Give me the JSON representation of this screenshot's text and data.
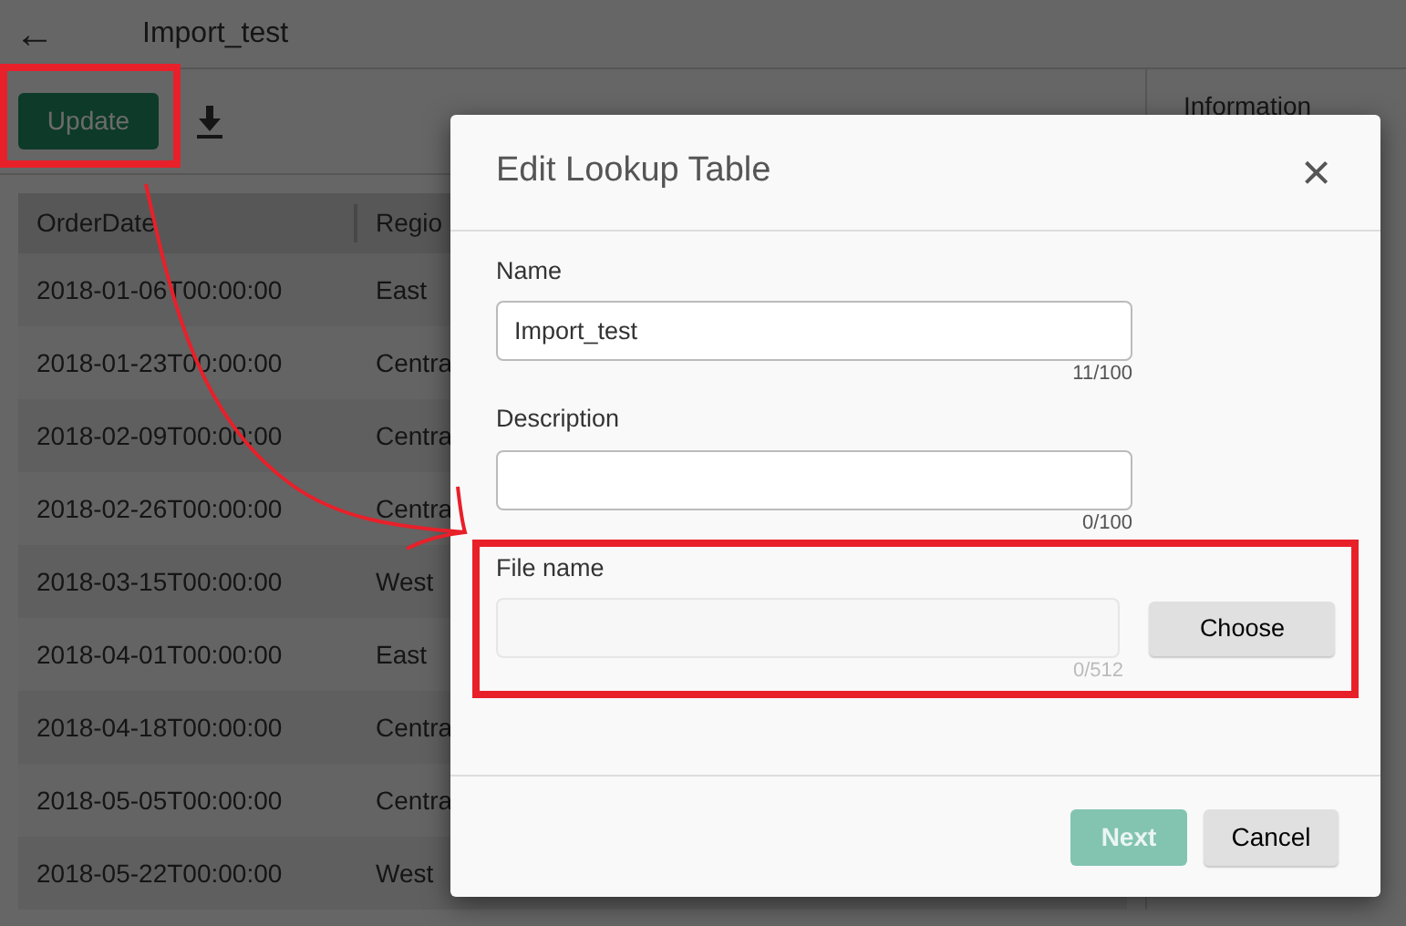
{
  "header": {
    "back_icon": "←",
    "title": "Import_test"
  },
  "toolbar": {
    "update_button": "Update"
  },
  "table": {
    "columns": [
      "OrderDate",
      "Regio"
    ],
    "rows": [
      [
        "2018-01-06T00:00:00",
        "East"
      ],
      [
        "2018-01-23T00:00:00",
        "Centra"
      ],
      [
        "2018-02-09T00:00:00",
        "Centra"
      ],
      [
        "2018-02-26T00:00:00",
        "Centra"
      ],
      [
        "2018-03-15T00:00:00",
        "West"
      ],
      [
        "2018-04-01T00:00:00",
        "East"
      ],
      [
        "2018-04-18T00:00:00",
        "Centra"
      ],
      [
        "2018-05-05T00:00:00",
        "Centra"
      ],
      [
        "2018-05-22T00:00:00",
        "West"
      ]
    ]
  },
  "side_panel": {
    "title": "Information"
  },
  "dialog": {
    "title": "Edit Lookup Table",
    "close": "×",
    "fields": [
      {
        "label": "Name",
        "value": "Import_test",
        "counter": "11/100",
        "disabled": false
      },
      {
        "label": "Description",
        "counter": "0/100",
        "disabled": false
      },
      {
        "label": "File name",
        "counter": "0/512",
        "disabled": true,
        "button": "Choose"
      }
    ],
    "buttons": [
      {
        "label": "Next",
        "kind": "primary",
        "disabled": true
      },
      {
        "label": "Cancel",
        "kind": "secondary",
        "disabled": false
      }
    ]
  },
  "annotations": [
    {
      "kind": "frame"
    },
    {
      "kind": "frame"
    },
    {
      "kind": "arrow"
    }
  ]
}
